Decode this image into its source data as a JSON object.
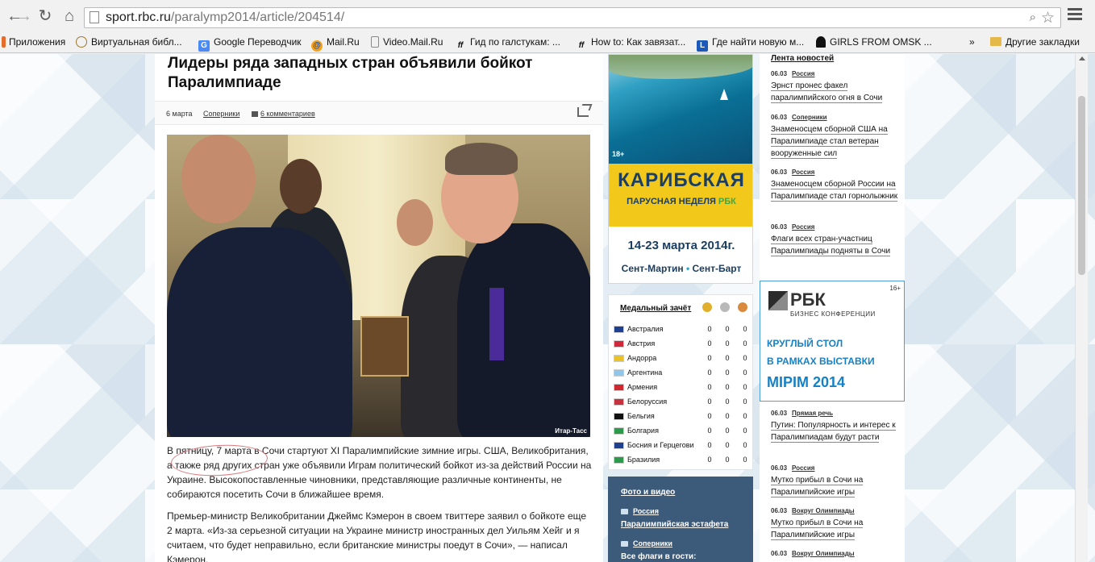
{
  "browser": {
    "url_host": "sport.rbc.ru",
    "url_path": "/paralymp2014/article/204514/",
    "back_icon": "arrow-left-icon",
    "forward_icon": "arrow-right-icon",
    "reload_icon": "reload-icon",
    "home_icon": "home-icon",
    "bookmarks": [
      {
        "label": "Приложения",
        "icon": "apps-icon"
      },
      {
        "label": "Виртуальная библ...",
        "icon": "library-icon"
      },
      {
        "label": "Google Переводчик",
        "icon": "translate-icon"
      },
      {
        "label": "Mail.Ru",
        "icon": "mailru-icon"
      },
      {
        "label": "Video.Mail.Ru",
        "icon": "page-icon"
      },
      {
        "label": "Гид по галстукам: ...",
        "icon": "ff-icon"
      },
      {
        "label": "How to: Как завязат...",
        "icon": "ff-icon"
      },
      {
        "label": "Где найти новую м...",
        "icon": "l-icon"
      },
      {
        "label": "GIRLS FROM OMSK ...",
        "icon": "bull-icon"
      }
    ],
    "bookmarks_more": "»",
    "other_bookmarks": "Другие закладки"
  },
  "article": {
    "headline": "Лидеры ряда западных стран объявили бойкот Паралимпиаде",
    "date": "6 марта",
    "category": "Соперники",
    "comments": "6 комментариев",
    "photo_credit": "Итар-Тасс",
    "paragraph1": "В пятницу, 7 марта в Сочи стартуют XI Паралимпийские зимние игры. США, Великобритания, а также ряд других стран уже объявили Играм политический бойкот из-за действий России на Украине. Высокопоставленные чиновники, представляющие различные континенты, не собираются посетить Сочи в ближайшее время.",
    "paragraph2": "Премьер-министр Великобритании Джеймс Кэмерон в своем твиттере заявил о бойкоте еще 2 марта. «Из-за серьезной ситуации на Украине министр иностранных дел Уильям Хейг и я считаем, что будет неправильно, если британские министры поедут в Сочи», — написал Кэмерон."
  },
  "carib_banner": {
    "age": "18+",
    "title": "КАРИБСКАЯ",
    "subtitle": "ПАРУСНАЯ НЕДЕЛЯ",
    "brand": "РБК",
    "dates": "14-23 марта 2014г.",
    "place1": "Сент-Мартин",
    "dot": "•",
    "place2": "Сент-Барт"
  },
  "medals": {
    "title": "Медальный зачёт",
    "colors": {
      "gold": "#e0b02c",
      "silver": "#b9b9b9",
      "bronze": "#d98a3c"
    },
    "rows": [
      {
        "country": "Австралия",
        "flag": "#1f3f8f",
        "g": "0",
        "s": "0",
        "b": "0"
      },
      {
        "country": "Австрия",
        "flag": "#d3283a",
        "g": "0",
        "s": "0",
        "b": "0"
      },
      {
        "country": "Андорра",
        "flag": "#e8c227",
        "g": "0",
        "s": "0",
        "b": "0"
      },
      {
        "country": "Аргентина",
        "flag": "#8fc6ea",
        "g": "0",
        "s": "0",
        "b": "0"
      },
      {
        "country": "Армения",
        "flag": "#d0282e",
        "g": "0",
        "s": "0",
        "b": "0"
      },
      {
        "country": "Белоруссия",
        "flag": "#c8313e",
        "g": "0",
        "s": "0",
        "b": "0"
      },
      {
        "country": "Бельгия",
        "flag": "#111111",
        "g": "0",
        "s": "0",
        "b": "0"
      },
      {
        "country": "Болгария",
        "flag": "#2b9a4a",
        "g": "0",
        "s": "0",
        "b": "0"
      },
      {
        "country": "Босния и Герцеговина",
        "flag": "#1f3f8f",
        "g": "0",
        "s": "0",
        "b": "0"
      },
      {
        "country": "Бразилия",
        "flag": "#2b9a4a",
        "g": "0",
        "s": "0",
        "b": "0"
      }
    ]
  },
  "photo_video": {
    "title": "Фото и видео",
    "items": [
      {
        "category": "Россия",
        "text": "Паралимпийская эстафета"
      },
      {
        "category": "Соперники",
        "text": "Все флаги в гости:"
      }
    ]
  },
  "news": {
    "title": "Лента новостей",
    "items": [
      {
        "date": "06.03",
        "category": "Россия",
        "text": "Эрнст пронес факел паралимпийского огня в Сочи"
      },
      {
        "date": "06.03",
        "category": "Соперники",
        "text": "Знаменосцем сборной США на Паралимпиаде стал ветеран вооруженные сил"
      },
      {
        "date": "06.03",
        "category": "Россия",
        "text": "Знаменосцем сборной России на Паралимпиаде стал горнолыжник"
      },
      {
        "date": "06.03",
        "category": "Россия",
        "text": "Флаги всех стран-участниц Паралимпиады подняты в Сочи"
      },
      {
        "date": "06.03",
        "category": "Прямая речь",
        "text": "Путин: Популярность и интерес к Паралимпиадам будут расти"
      },
      {
        "date": "06.03",
        "category": "Россия",
        "text": "Мутко прибыл в Сочи на Паралимпийские игры"
      },
      {
        "date": "06.03",
        "category": "Вокруг Олимпиады",
        "text": "Мутко прибыл в Сочи на Паралимпийские игры"
      },
      {
        "date": "06.03",
        "category": "Вокруг Олимпиады",
        "text": ""
      }
    ]
  },
  "rbk_banner": {
    "age": "16+",
    "brand": "РБК",
    "brand_sub": "БИЗНЕС КОНФЕРЕНЦИИ",
    "line1": "КРУГЛЫЙ СТОЛ",
    "line2": "В РАМКАХ ВЫСТАВКИ",
    "line3": "MIPIM 2014"
  }
}
